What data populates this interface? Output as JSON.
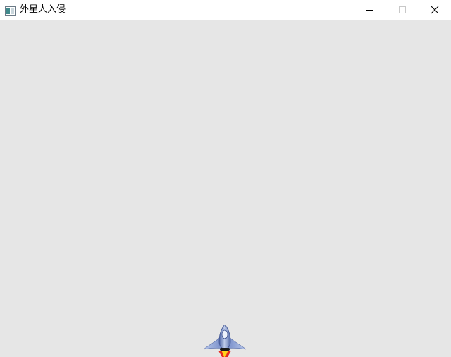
{
  "window": {
    "title": "外星人入侵",
    "app_icon": "window-app-icon",
    "controls": {
      "minimize": "minimize-icon",
      "maximize": "maximize-icon",
      "close": "close-icon"
    }
  },
  "game": {
    "background_color": "#e6e6e6",
    "player_ship": {
      "icon": "spaceship-icon",
      "colors": {
        "hull": "#6f86c4",
        "hull_light": "#c3d0ee",
        "flame_outer": "#e62a1e",
        "flame_inner": "#ffd21a"
      }
    }
  }
}
